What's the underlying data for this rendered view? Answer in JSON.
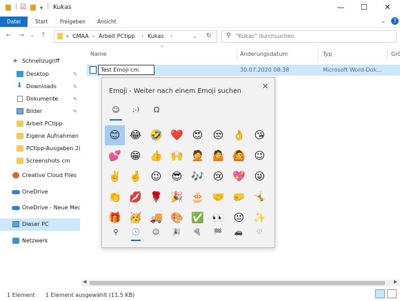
{
  "window": {
    "title": "Kukas",
    "quick_access_icons": [
      "folder-icon",
      "checklist-icon",
      "folder-icon",
      "dropdown-arrow-icon"
    ],
    "controls": {
      "minimize": "—",
      "maximize": "☐",
      "close": "✕"
    }
  },
  "ribbon": {
    "tabs": [
      "Datei",
      "Start",
      "Freigeben",
      "Ansicht"
    ],
    "expand": "⌄",
    "help": "?"
  },
  "nav": {
    "back": "←",
    "forward": "→",
    "recent": "⌄",
    "up": "↑",
    "breadcrumb": [
      "CMAA",
      "Arbeit PCtipp",
      "Kukas"
    ],
    "overflow": "«",
    "refresh": "↻",
    "search_placeholder": "\"Kukas\" durchsuchen"
  },
  "sidebar": {
    "items": [
      {
        "label": "Schnellzugriff",
        "icon": "star-icon",
        "pinned": false
      },
      {
        "label": "Desktop",
        "icon": "desktop-icon",
        "pinned": true
      },
      {
        "label": "Downloads",
        "icon": "download-icon",
        "pinned": true
      },
      {
        "label": "Dokumente",
        "icon": "documents-icon",
        "pinned": true
      },
      {
        "label": "Bilder",
        "icon": "pictures-icon",
        "pinned": true
      },
      {
        "label": "Arbeit PCtipp",
        "icon": "folder-icon",
        "pinned": false
      },
      {
        "label": "Eigene Aufnahmen",
        "icon": "folder-icon",
        "pinned": false
      },
      {
        "label": "PCtipp-Ausgaben 2(",
        "icon": "folder-icon",
        "pinned": false
      },
      {
        "label": "Screenshots cm",
        "icon": "folder-icon",
        "pinned": false
      },
      {
        "label": "Creative Cloud Files",
        "icon": "creative-cloud-icon",
        "pinned": false
      },
      {
        "label": "OneDrive",
        "icon": "onedrive-icon",
        "pinned": false
      },
      {
        "label": "OneDrive - Neue Mec",
        "icon": "onedrive-icon",
        "pinned": false
      },
      {
        "label": "Dieser PC",
        "icon": "pc-icon",
        "pinned": false
      },
      {
        "label": "Netzwerk",
        "icon": "network-icon",
        "pinned": false
      }
    ],
    "pin_glyph": "📌"
  },
  "columns": {
    "name": "Name",
    "date": "Änderungsdatum",
    "type": "Typ",
    "size": "Grö"
  },
  "file": {
    "name_editing": "Test Emoji cm",
    "date": "30.07.2020 08:38",
    "type": "Microsoft Word-Dok..."
  },
  "emoji_panel": {
    "title": "Emoji - Weiter nach einem Emoji suchen",
    "close": "✕",
    "category_tabs": [
      "☺",
      ";-)",
      "Ω"
    ],
    "emojis": [
      "😊",
      "😂",
      "🤣",
      "❤️",
      "😍",
      "😒",
      "👌",
      "😘",
      "💕",
      "😁",
      "👍",
      "🙌",
      "🤦",
      "🤷",
      "🙆",
      "😉",
      "✌️",
      "🤞",
      "😉",
      "😎",
      "🎶",
      "😢",
      "💖",
      "😜",
      "👏",
      "💋",
      "🌹",
      "🎉",
      "🎂",
      "🤝",
      "🤛",
      "🤸",
      "🎁",
      "🥳",
      "🚚",
      "🎨",
      "✅",
      "👀",
      "😐",
      "✨"
    ],
    "bottom_categories": [
      "⚲",
      "🕓",
      "☺",
      "🎉",
      "🍕",
      "🏁",
      "🚗",
      "♡"
    ]
  },
  "status": {
    "count": "1 Element",
    "selected": "1 Element ausgewählt (11.5 KB)"
  },
  "colors": {
    "accent": "#1a6fc4",
    "selection": "#cce8ff",
    "panel": "#f2f2f2"
  }
}
